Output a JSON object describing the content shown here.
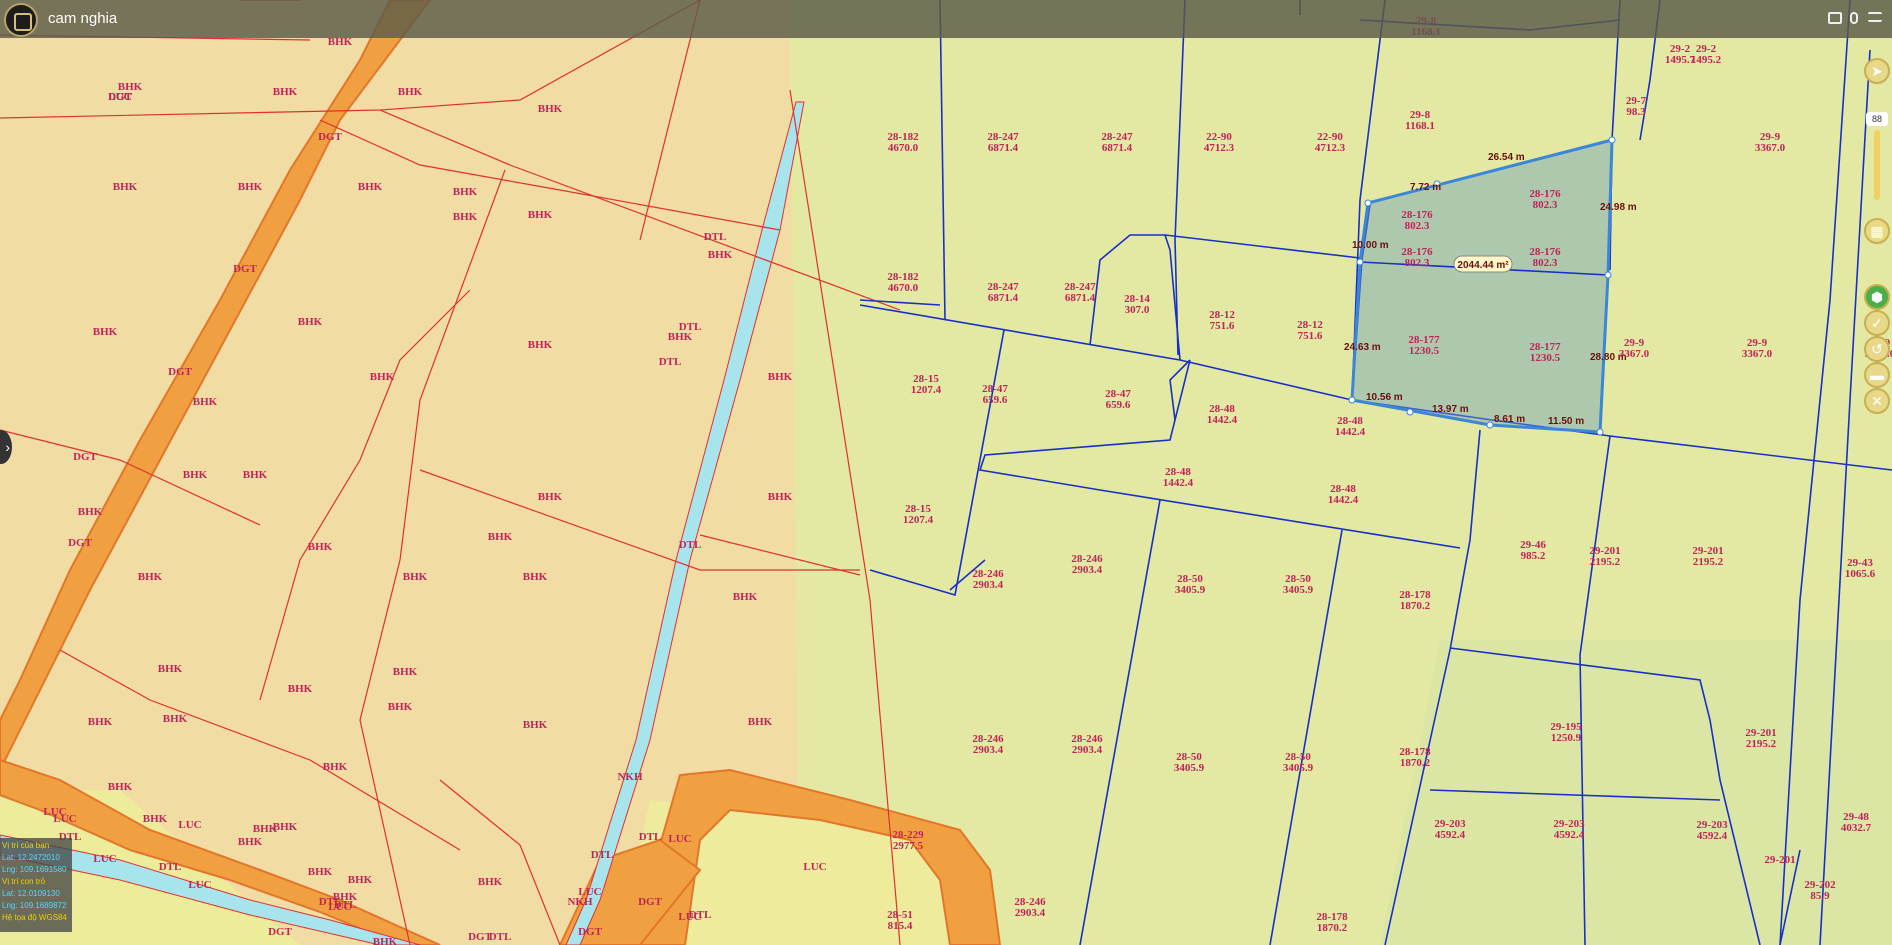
{
  "header": {
    "title": "cam nghia"
  },
  "gps_panel": {
    "your_location_label": "Vị trí của bạn",
    "your_lat": "Lat: 12.2472010",
    "your_lng": "Lng: 109.1691580",
    "cursor_label": "Vị trí con trỏ",
    "cursor_lat": "Lat: 12.0109130",
    "cursor_lng": "Lng: 109.1689872",
    "coord_system": "Hệ tọa độ WGS84"
  },
  "zoom_level": "88",
  "selection": {
    "area": "2044.44 m²",
    "edges": [
      "7.72 m",
      "26.54 m",
      "24.98 m",
      "28.80 m",
      "11.50 m",
      "8.61 m",
      "13.97 m",
      "10.56 m",
      "24.63 m",
      "10.00 m"
    ]
  },
  "colors": {
    "road": "#f0a040",
    "canal": "#a8e4ec",
    "boundary_red": "#e23030",
    "boundary_blue": "#1830c8",
    "selection": "#3a86d8"
  },
  "icons": [
    "logo-icon",
    "list-icon",
    "mic-icon",
    "menu-icon",
    "navigate-icon",
    "layers-icon",
    "polygon-icon",
    "check-icon",
    "undo-icon",
    "delete-icon",
    "close-icon",
    "expand-left-icon"
  ],
  "parcel_labels": [
    "BHK",
    "BHK",
    "BHK",
    "BHK",
    "BHK",
    "DGT",
    "BHK",
    "BHK",
    "BHK",
    "BHK",
    "BHK",
    "DGT",
    "BHK",
    "BHK",
    "BHK",
    "BHK",
    "BHK",
    "BHK",
    "DGT",
    "BHK",
    "BHK",
    "BHK",
    "DGT",
    "BHK",
    "BHK",
    "BHK",
    "BHK",
    "BHK",
    "BHK",
    "DGT",
    "BHK",
    "BHK",
    "BHK",
    "BHK",
    "BHK",
    "BHK",
    "BHK",
    "BHK",
    "BHK",
    "BHK",
    "BHK",
    "BHK",
    "BHK",
    "BHK",
    "BHK",
    "BHK",
    "BHK",
    "BHK",
    "BHK",
    "DGT",
    "BHK",
    "BHK",
    "BHK",
    "BHK",
    "BHK",
    "DGT",
    "DGT",
    "DGT",
    "LUC",
    "LUC",
    "LUC",
    "LUC",
    "LUC",
    "LUC",
    "LUC",
    "LUC",
    "LUC",
    "LUC",
    "DTL",
    "DTL",
    "DTL",
    "DTL",
    "DTL",
    "DTL",
    "DTL",
    "DTL",
    "DTL",
    "DTL",
    "DTL",
    "DTL",
    "NKH",
    "NKH",
    "DGT",
    "DGT",
    "LUC"
  ],
  "east_labels": [
    "28-182 4670.0",
    "28-247 6871.4",
    "28-247 6871.4",
    "22-90 4712.3",
    "22-90 4712.3",
    "29-8 1168.1",
    "29-8 1168.1",
    "29-9 3367.0",
    "29-7 98.3",
    "28-176 802.3",
    "28-176 802.3",
    "28-176 802.3",
    "28-176 802.3",
    "28-182 4670.0",
    "28-247 6871.4",
    "28-247 6871.4",
    "28-14 307.0",
    "28-12 751.6",
    "28-12 751.6",
    "28-177 1230.5",
    "28-177 1230.5",
    "29-9 3367.0",
    "29-9 3367.0",
    "29-9 3367.0",
    "28-15 1207.4",
    "28-47 659.6",
    "28-47 659.6",
    "28-48 1442.4",
    "28-48 1442.4",
    "28-48 1442.4",
    "28-48 1442.4",
    "28-15 1207.4",
    "28-246 2903.4",
    "28-246 2903.4",
    "28-50 3405.9",
    "28-50 3405.9",
    "28-178 1870.2",
    "29-46 985.2",
    "29-201 2195.2",
    "29-201 2195.2",
    "29-43 1065.6",
    "28-246 2903.4",
    "28-246 2903.4",
    "28-50 3405.9",
    "28-50 3405.9",
    "28-178 1870.2",
    "29-195 1250.9",
    "29-201 2195.2",
    "29-203 4592.4",
    "29-203 4592.4",
    "29-203 4592.4",
    "29-48 4032.7",
    "28-51 815.4",
    "28-229 2977.5",
    "28-246 2903.4",
    "28-178 1870.2",
    "29-201",
    "29-202 85.9",
    "29-2 1495.7",
    "29-2 1495.2"
  ]
}
